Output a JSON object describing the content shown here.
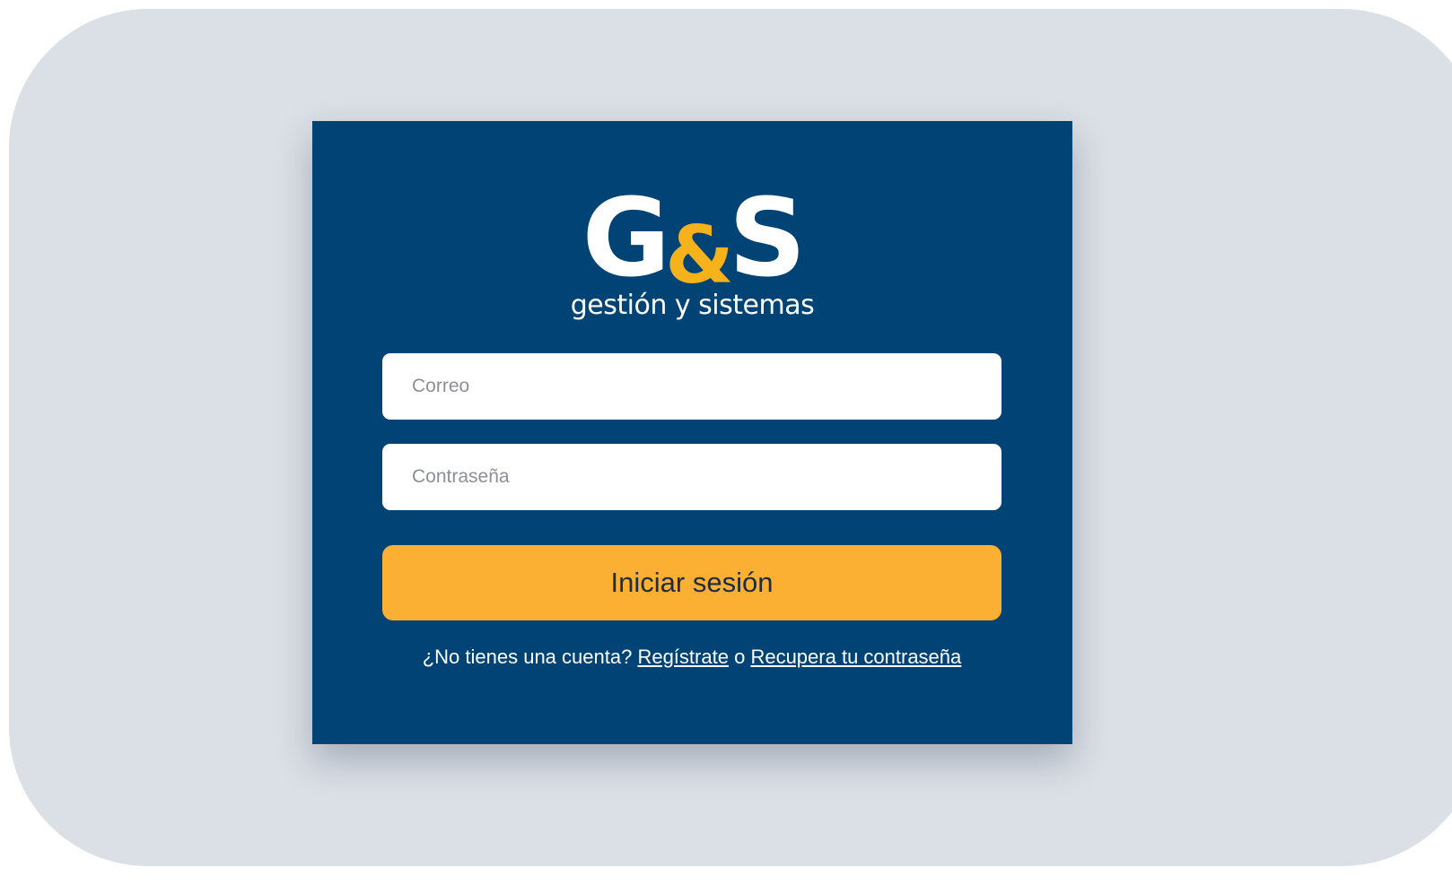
{
  "brand": {
    "mark_left": "G",
    "mark_amp": "&",
    "mark_right": "S",
    "tagline": "gestión y sistemas",
    "primary_color": "#004374",
    "accent_color": "#fbb034"
  },
  "form": {
    "email_placeholder": "Correo",
    "email_value": "",
    "password_placeholder": "Contraseña",
    "password_value": "",
    "submit_label": "Iniciar sesión"
  },
  "footer": {
    "prompt": "¿No tienes una cuenta?",
    "register_link": "Regístrate",
    "separator": "o",
    "recover_link": "Recupera tu contraseña"
  }
}
